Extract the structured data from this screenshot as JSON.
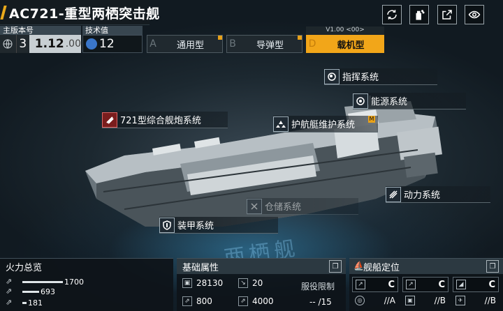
{
  "header": {
    "title": "AC721-重型两栖突击舰"
  },
  "version": {
    "label": "主版本号",
    "major": "3",
    "number": "1.12",
    "sub": ".00"
  },
  "tech": {
    "label": "技术值",
    "value": "12"
  },
  "tabs": [
    {
      "letter": "A",
      "label": "通用型"
    },
    {
      "letter": "B",
      "label": "导弹型"
    },
    {
      "letter": "D",
      "label": "载机型"
    }
  ],
  "active_tab_version": "V1.00 <00>",
  "systems": {
    "command": "指挥系统",
    "energy": "能源系统",
    "gun": "721型综合舰炮系统",
    "escort": "护航艇维护系统",
    "power": "动力系统",
    "storage": "仓储系统",
    "armor": "装甲系统",
    "escort_badge": "M"
  },
  "watermark": "两栖舰",
  "firepower": {
    "title": "火力总览",
    "rows": [
      {
        "value": "1700",
        "fraction": 1.0
      },
      {
        "value": "693",
        "fraction": 0.41
      },
      {
        "value": "181",
        "fraction": 0.11
      }
    ]
  },
  "base_attrs": {
    "title": "基础属性",
    "hp": "28130",
    "armor": "20",
    "speed": "800",
    "range": "4000",
    "service_limit_label": "服役限制",
    "service_limit_value": "-- /15"
  },
  "positioning": {
    "title": "舰船定位",
    "grades": [
      "C",
      "C",
      "C"
    ],
    "sub_grades": [
      "A",
      "B",
      "B"
    ],
    "sub_prefix": "//"
  },
  "colors": {
    "accent": "#f2a619",
    "panel_bg": "#0e1419",
    "ship_glow": "#3caae6"
  }
}
